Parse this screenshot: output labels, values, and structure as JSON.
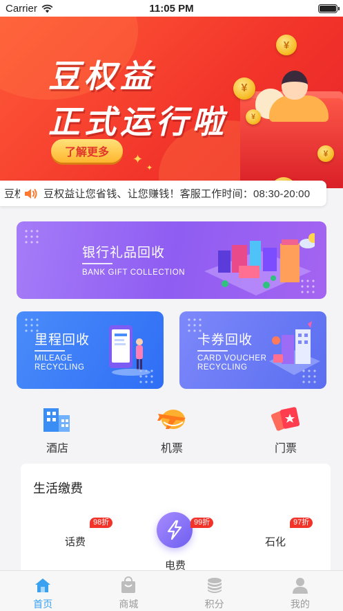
{
  "status_bar": {
    "carrier": "Carrier",
    "time": "11:05 PM"
  },
  "banner": {
    "title_line1": "豆权益",
    "title_line2": "正式运行啦",
    "button_label": "了解更多",
    "coin_symbol": "¥",
    "page_count": 2,
    "active_page": 2
  },
  "notice": {
    "prefix": "豆权",
    "text": "豆权益让您省钱、让您赚钱！客服工作时间：08:30-20:00"
  },
  "cards": {
    "bank": {
      "title": "银行礼品回收",
      "subtitle": "BANK GIFT COLLECTION"
    },
    "mileage": {
      "title": "里程回收",
      "subtitle_line1": "MILEAGE",
      "subtitle_line2": "RECYCLING"
    },
    "voucher": {
      "title": "卡券回收",
      "subtitle_line1": "CARD VOUCHER",
      "subtitle_line2": "RECYCLING"
    }
  },
  "quick_links": [
    {
      "label": "酒店",
      "icon": "hotel-building-icon"
    },
    {
      "label": "机票",
      "icon": "airplane-ticket-icon"
    },
    {
      "label": "门票",
      "icon": "admission-ticket-icon"
    }
  ],
  "utility": {
    "title": "生活缴费",
    "items": [
      {
        "label": "话费",
        "badge": "98折"
      },
      {
        "label": "电费",
        "badge": "99折",
        "icon": "lightning-icon"
      },
      {
        "label": "石化",
        "badge": "97折"
      }
    ]
  },
  "tabbar": {
    "tabs": [
      {
        "label": "首页",
        "icon": "home-icon",
        "active": true
      },
      {
        "label": "商城",
        "icon": "shopping-bag-icon",
        "active": false
      },
      {
        "label": "积分",
        "icon": "coin-stack-icon",
        "active": false
      },
      {
        "label": "我的",
        "icon": "profile-icon",
        "active": false
      }
    ]
  },
  "colors": {
    "banner_red": "#f2342a",
    "bank_card": "#9a66f3",
    "mileage_card": "#3a7df8",
    "voucher_card": "#6c7cf5",
    "tab_active": "#3aa0f0",
    "discount_badge": "#f2332a"
  }
}
